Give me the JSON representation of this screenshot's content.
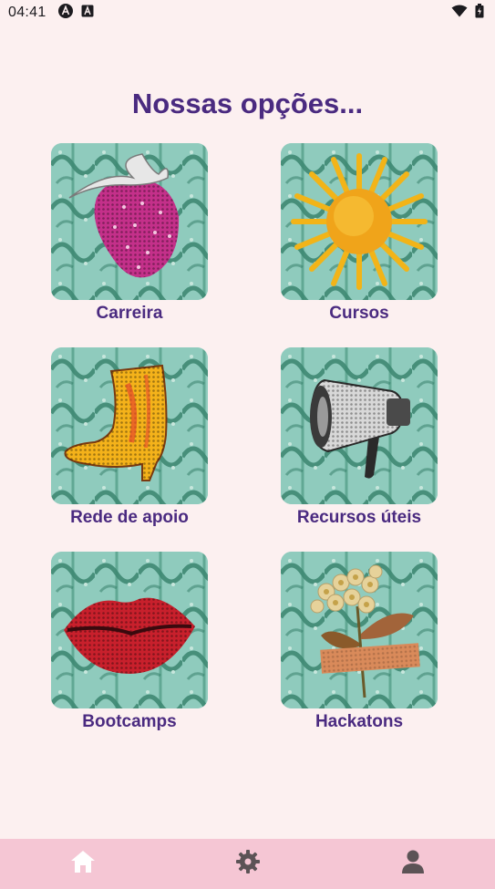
{
  "status_bar": {
    "time": "04:41",
    "left_icons": [
      "a-circle-icon",
      "a-square-icon"
    ],
    "right_icons": [
      "wifi-icon",
      "battery-icon"
    ]
  },
  "header": {
    "title": "Nossas opções..."
  },
  "options": [
    {
      "label": "Carreira",
      "icon": "strawberry-image"
    },
    {
      "label": "Cursos",
      "icon": "sun-image"
    },
    {
      "label": "Rede de apoio",
      "icon": "boot-image"
    },
    {
      "label": "Recursos úteis",
      "icon": "megaphone-image"
    },
    {
      "label": "Bootcamps",
      "icon": "lips-image"
    },
    {
      "label": "Hackatons",
      "icon": "flower-image"
    }
  ],
  "bottom_nav": {
    "items": [
      {
        "name": "home",
        "icon": "home-icon"
      },
      {
        "name": "settings",
        "icon": "gear-icon"
      },
      {
        "name": "profile",
        "icon": "person-icon"
      }
    ],
    "active": "home"
  },
  "colors": {
    "background": "#fcf0f0",
    "title": "#4a2a80",
    "nav_bg": "#f5c6d4",
    "tile_bg": "#8fcbbd"
  }
}
